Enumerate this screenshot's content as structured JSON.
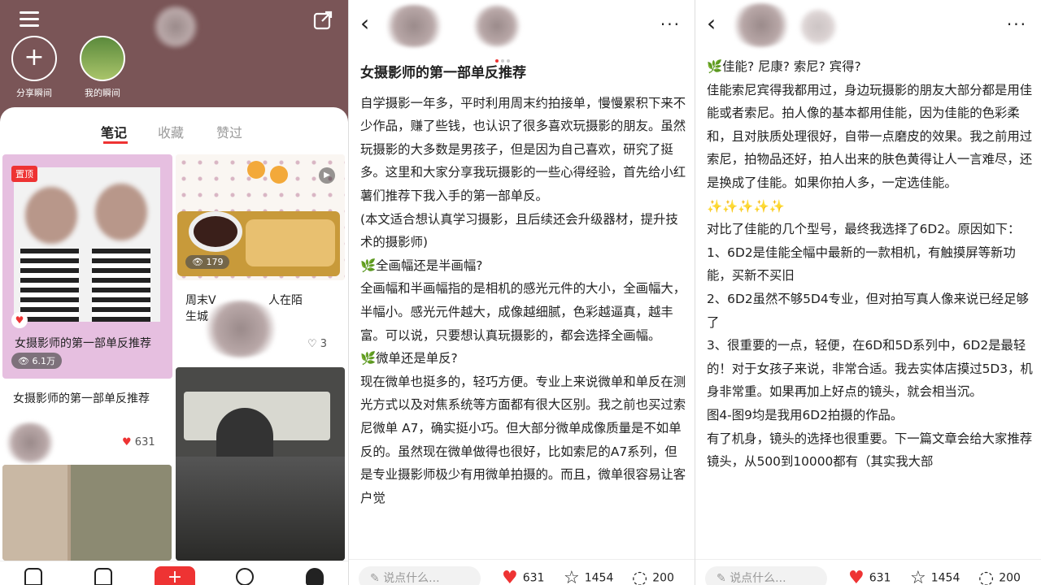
{
  "profile": {
    "moments": [
      {
        "label": "分享瞬间",
        "icon": "plus-icon"
      },
      {
        "label": "我的瞬间",
        "icon": "field-thumbnail"
      }
    ],
    "tabs": [
      {
        "label": "笔记",
        "active": true
      },
      {
        "label": "收藏",
        "active": false
      },
      {
        "label": "赞过",
        "active": false
      }
    ],
    "cards": [
      {
        "badge": "置顶",
        "overlay_title": "女摄影师的第一部单反推荐",
        "views": "6.1万",
        "title": "女摄影师的第一部单反推荐",
        "likes": "631"
      },
      {
        "views": "179",
        "title_visible": "周末V",
        "title_visible_2": "人在陌",
        "title_line2": "生城",
        "likes": "3"
      }
    ]
  },
  "article_page": {
    "title": "女摄影师的第一部单反推荐",
    "paragraphs": [
      "自学摄影一年多，平时利用周末约拍接单，慢慢累积下来不少作品，赚了些钱，也认识了很多喜欢玩摄影的朋友。虽然玩摄影的大多数是男孩子，但是因为自己喜欢，研究了挺多。这里和大家分享我玩摄影的一些心得经验，首先给小红薯们推荐下我入手的第一部单反。",
      "(本文适合想认真学习摄影，且后续还会升级器材，提升技术的摄影师)",
      "🌿全画幅还是半画幅?",
      "全画幅和半画幅指的是相机的感光元件的大小，全画幅大，半幅小。感光元件越大，成像越细腻，色彩越逼真，越丰富。可以说，只要想认真玩摄影的，都会选择全画幅。",
      "🌿微单还是单反?",
      "现在微单也挺多的，轻巧方便。专业上来说微单和单反在测光方式以及对焦系统等方面都有很大区别。我之前也买过索尼微单 A7，确实挺小巧。但大部分微单成像质量是不如单反的。虽然现在微单做得也很好，比如索尼的A7系列，但是专业摄影师极少有用微单拍摄的。而且，微单很容易让客户觉"
    ]
  },
  "article_page_2": {
    "paragraphs": [
      "🌿佳能? 尼康? 索尼? 宾得?",
      "佳能索尼宾得我都用过，身边玩摄影的朋友大部分都是用佳能或者索尼。拍人像的基本都用佳能，因为佳能的色彩柔和，且对肤质处理很好，自带一点磨皮的效果。我之前用过索尼，拍物品还好，拍人出来的肤色黄得让人一言难尽，还是换成了佳能。如果你拍人多，一定选佳能。",
      "✨✨✨✨✨",
      "对比了佳能的几个型号，最终我选择了6D2。原因如下：",
      "1、6D2是佳能全幅中最新的一款相机，有触摸屏等新功能，买新不买旧",
      "2、6D2虽然不够5D4专业，但对拍写真人像来说已经足够了",
      "3、很重要的一点，轻便，在6D和5D系列中，6D2是最轻的！对于女孩子来说，非常合适。我去实体店摸过5D3，机身非常重。如果再加上好点的镜头，就会相当沉。",
      "图4-图9均是我用6D2拍摄的作品。",
      "有了机身，镜头的选择也很重要。下一篇文章会给大家推荐镜头，从500到10000都有（其实我大部"
    ]
  },
  "bottom_bar": {
    "comment_placeholder": "说点什么...",
    "likes": "631",
    "favorites": "1454",
    "comments": "200"
  },
  "colors": {
    "accent": "#e33333",
    "profile_header": "#7a5557",
    "pinned_card_bg": "#e6bfe0"
  }
}
